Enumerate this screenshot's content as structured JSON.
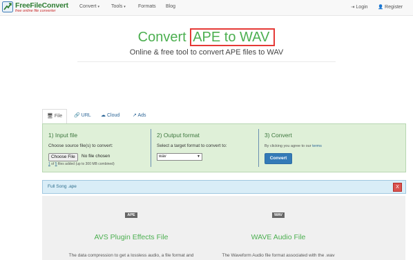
{
  "brand": {
    "name": "FreeFileConvert",
    "tagline": "free online file converter"
  },
  "nav": {
    "items": [
      {
        "label": "Convert",
        "caret": "▾"
      },
      {
        "label": "Tools",
        "caret": "▾"
      },
      {
        "label": "Formats"
      },
      {
        "label": "Blog"
      }
    ],
    "login": {
      "icon": "login-icon",
      "label": "Login"
    },
    "register": {
      "icon": "user-icon",
      "label": "Register"
    }
  },
  "hero": {
    "title_prefix": "Convert",
    "title_highlight": "APE to WAV",
    "subtitle": "Online & free tool to convert APE files to WAV",
    "highlight_color": "#e53935"
  },
  "tabs": [
    {
      "icon": "monitor-icon",
      "label": "File",
      "active": true
    },
    {
      "icon": "link-icon",
      "label": "URL"
    },
    {
      "icon": "cloud-icon",
      "label": "Cloud"
    },
    {
      "icon": "external-link-icon",
      "label": "Ads"
    }
  ],
  "steps": {
    "input": {
      "title": "1) Input file",
      "desc": "Choose source file(s) to convert:",
      "choose_label": "Choose File",
      "no_file": "No file chosen",
      "files_count": "1",
      "files_of": "of",
      "files_max": "5",
      "files_suffix": "files added (up to 300 MB combined)"
    },
    "output": {
      "title": "2) Output format",
      "desc": "Select a target format to convert to:",
      "selected": "wav"
    },
    "convert": {
      "title": "3) Convert",
      "terms_prefix": "By clicking you agree to our",
      "terms_link": "terms",
      "button_label": "Convert"
    }
  },
  "file_bar": {
    "name": "Full Song .ape",
    "remove": "X"
  },
  "formats": {
    "left": {
      "badge": "APE",
      "title": "AVS Plugin Effects File",
      "desc": "The data compression to get a lossless audio, a file format and"
    },
    "right": {
      "badge": "WAV",
      "title": "WAVE Audio File",
      "desc": "The Waveform Audio file format associated with the .wav"
    }
  },
  "colors": {
    "brand_green": "#4caf50",
    "link_blue": "#2a6496",
    "primary_button": "#337ab7",
    "danger": "#d9534f"
  }
}
